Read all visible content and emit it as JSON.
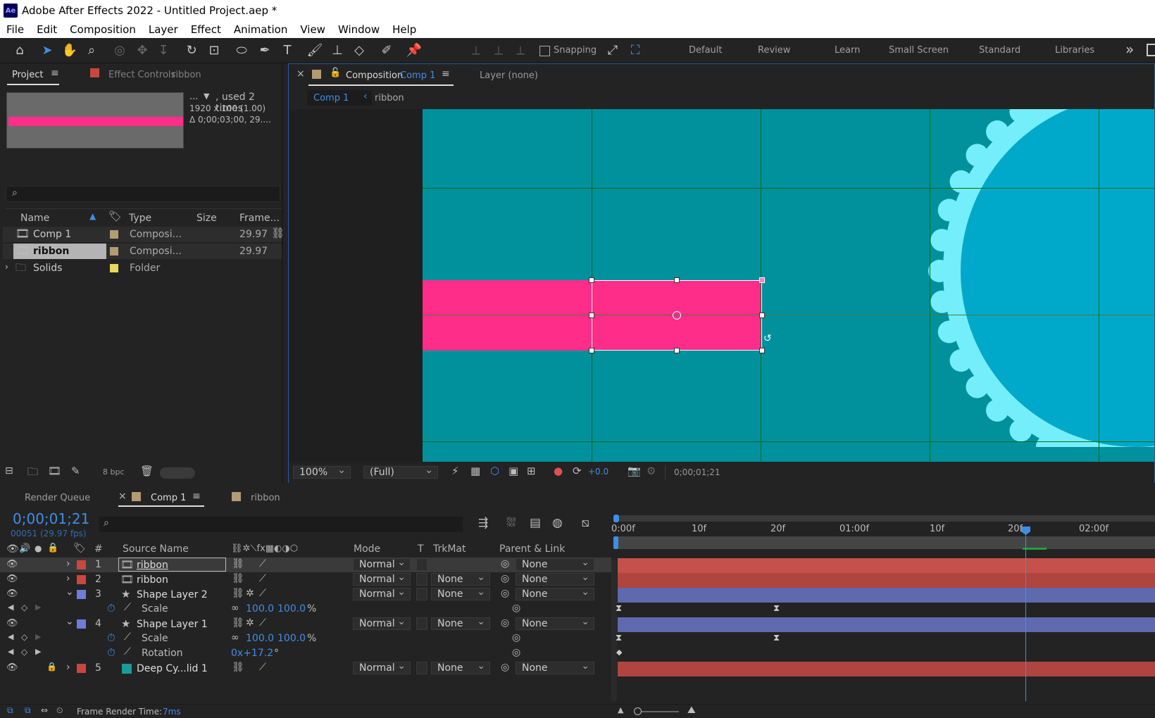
{
  "titlebar": {
    "app_icon": "Ae",
    "title": "Adobe After Effects 2022 - Untitled Project.aep *"
  },
  "menu": [
    "File",
    "Edit",
    "Composition",
    "Layer",
    "Effect",
    "Animation",
    "View",
    "Window",
    "Help"
  ],
  "toolbar": {
    "snapping_label": "Snapping",
    "workspaces": [
      "Default",
      "Review",
      "Learn",
      "Small Screen",
      "Standard",
      "Libraries"
    ],
    "more": "»"
  },
  "project": {
    "tab": "Project",
    "tab2": "Effect Controls",
    "tab2_target": "ribbon",
    "info_used": ", used 2 times",
    "info_dots": "...",
    "info_size": "1920 x 100 (1.00)",
    "info_duration": "Δ 0;00;03;00, 29....",
    "columns": {
      "name": "Name",
      "type": "Type",
      "size": "Size",
      "frame": "Frame..."
    },
    "items": [
      {
        "name": "Comp 1",
        "type": "Composi...",
        "frame": "29.97",
        "color": "#b39b72"
      },
      {
        "name": "ribbon",
        "type": "Composi...",
        "frame": "29.97",
        "color": "#b39b72"
      },
      {
        "name": "Solids",
        "type": "Folder",
        "frame": "",
        "color": "#e9d85a"
      }
    ],
    "bpc": "8 bpc"
  },
  "comp": {
    "tab_prefix": "Composition",
    "tab_name": "Comp 1",
    "layer_tab": "Layer (none)",
    "breadcrumb": [
      "Comp 1",
      "ribbon"
    ],
    "zoom": "100%",
    "resolution": "(Full)",
    "exposure": "+0.0",
    "timecode": "0;00;01;21"
  },
  "timeline": {
    "tabs": {
      "render_queue": "Render Queue",
      "comp1": "Comp 1",
      "ribbon": "ribbon"
    },
    "timecode": "0;00;01;21",
    "frames": "00051 (29.97 fps)",
    "columns": {
      "num": "#",
      "source": "Source Name",
      "mode": "Mode",
      "t": "T",
      "trkmat": "TrkMat",
      "parent": "Parent & Link"
    },
    "ruler": [
      "0:00f",
      "10f",
      "20f",
      "01:00f",
      "10f",
      "20f",
      "02:00f"
    ],
    "layers": [
      {
        "num": "1",
        "name": "ribbon",
        "color": "#c8473e",
        "mode": "Normal",
        "trkmat": "",
        "parent": "None",
        "bar": "#c4514b"
      },
      {
        "num": "2",
        "name": "ribbon",
        "color": "#c8473e",
        "mode": "Normal",
        "trkmat": "None",
        "parent": "None",
        "bar": "#b0443f"
      },
      {
        "num": "3",
        "name": "Shape Layer 2",
        "color": "#6c7ed8",
        "mode": "Normal",
        "trkmat": "None",
        "parent": "None",
        "bar": "#5f69ad"
      },
      {
        "prop": "Scale",
        "value1": "100.0",
        "value2": "100.0",
        "unit": "%"
      },
      {
        "num": "4",
        "name": "Shape Layer 1",
        "color": "#6c7ed8",
        "mode": "Normal",
        "trkmat": "None",
        "parent": "None",
        "bar": "#5f69ad"
      },
      {
        "prop": "Scale",
        "value1": "100.0",
        "value2": "100.0",
        "unit": "%"
      },
      {
        "prop": "Rotation",
        "value1": "0x+17.2",
        "value2": "",
        "unit": "°"
      },
      {
        "num": "5",
        "name": "Deep Cy...lid 1",
        "color": "#c8473e",
        "swatch": "#1a9c9c",
        "mode": "Normal",
        "trkmat": "None",
        "parent": "None",
        "bar": "#b0443f"
      }
    ],
    "status": {
      "label": "Frame Render Time:",
      "value": "7ms"
    }
  },
  "colors": {
    "canvas": "#00919d",
    "ribbon": "#ff2d8a",
    "gear": "#74eefa",
    "circle": "#00a9c9"
  }
}
